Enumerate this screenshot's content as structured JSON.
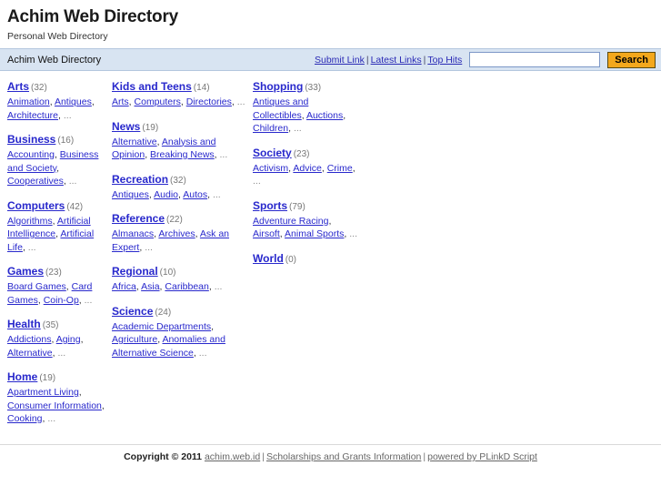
{
  "header": {
    "title": "Achim Web Directory",
    "tagline": "Personal Web Directory"
  },
  "navbar": {
    "breadcrumb": "Achim Web Directory",
    "links": [
      {
        "label": "Submit Link"
      },
      {
        "label": "Latest Links"
      },
      {
        "label": "Top Hits"
      }
    ],
    "separator": "|",
    "search": {
      "value": "",
      "placeholder": "",
      "button_label": "Search"
    }
  },
  "colors": {
    "navbar_bg": "#d8e4f2",
    "link": "#2828cc",
    "count": "#777777",
    "search_button_bg": "#f3a81d"
  },
  "categories": {
    "columns": [
      [
        {
          "name": "Arts",
          "count": "(32)",
          "subs": [
            "Animation",
            "Antiques",
            "Architecture"
          ],
          "more": "..."
        },
        {
          "name": "Business",
          "count": "(16)",
          "subs": [
            "Accounting",
            "Business and Society",
            "Cooperatives"
          ],
          "more": "..."
        },
        {
          "name": "Computers",
          "count": "(42)",
          "subs": [
            "Algorithms",
            "Artificial Intelligence",
            "Artificial Life"
          ],
          "more": "..."
        },
        {
          "name": "Games",
          "count": "(23)",
          "subs": [
            "Board Games",
            "Card Games",
            "Coin-Op"
          ],
          "more": "..."
        },
        {
          "name": "Health",
          "count": "(35)",
          "subs": [
            "Addictions",
            "Aging",
            "Alternative"
          ],
          "more": "..."
        },
        {
          "name": "Home",
          "count": "(19)",
          "subs": [
            "Apartment Living",
            "Consumer Information",
            "Cooking"
          ],
          "more": "..."
        }
      ],
      [
        {
          "name": "Kids and Teens",
          "count": "(14)",
          "subs": [
            "Arts",
            "Computers",
            "Directories"
          ],
          "more": "..."
        },
        {
          "name": "News",
          "count": "(19)",
          "subs": [
            "Alternative",
            "Analysis and Opinion",
            "Breaking News"
          ],
          "more": "..."
        },
        {
          "name": "Recreation",
          "count": "(32)",
          "subs": [
            "Antiques",
            "Audio",
            "Autos"
          ],
          "more": "..."
        },
        {
          "name": "Reference",
          "count": "(22)",
          "subs": [
            "Almanacs",
            "Archives",
            "Ask an Expert"
          ],
          "more": "..."
        },
        {
          "name": "Regional",
          "count": "(10)",
          "subs": [
            "Africa",
            "Asia",
            "Caribbean"
          ],
          "more": "..."
        },
        {
          "name": "Science",
          "count": "(24)",
          "subs": [
            "Academic Departments",
            "Agriculture",
            "Anomalies and Alternative Science"
          ],
          "more": "..."
        }
      ],
      [
        {
          "name": "Shopping",
          "count": "(33)",
          "subs": [
            "Antiques and Collectibles",
            "Auctions",
            "Children"
          ],
          "more": "..."
        },
        {
          "name": "Society",
          "count": "(23)",
          "subs": [
            "Activism",
            "Advice",
            "Crime"
          ],
          "more": "..."
        },
        {
          "name": "Sports",
          "count": "(79)",
          "subs": [
            "Adventure Racing",
            "Airsoft",
            "Animal Sports"
          ],
          "more": "..."
        },
        {
          "name": "World",
          "count": "(0)",
          "subs": [],
          "more": ""
        }
      ]
    ]
  },
  "footer": {
    "copyright": "Copyright © 2011",
    "links": [
      {
        "label": "achim.web.id"
      },
      {
        "label": "Scholarships and Grants Information"
      },
      {
        "label": "powered by PLinkD Script"
      }
    ],
    "separator": "|"
  }
}
